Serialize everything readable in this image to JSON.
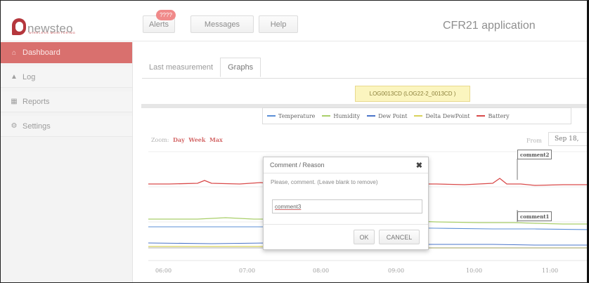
{
  "brand": {
    "name": "newsteo",
    "tagline": "WIRELESS MONITORING"
  },
  "header": {
    "buttons": {
      "alerts": "Alerts",
      "messages": "Messages",
      "help": "Help"
    },
    "alerts_badge": "????",
    "app_title": "CFR21 application"
  },
  "sidebar": {
    "items": [
      {
        "label": "Dashboard",
        "icon": "home-icon"
      },
      {
        "label": "Log",
        "icon": "log-icon"
      },
      {
        "label": "Reports",
        "icon": "reports-icon"
      },
      {
        "label": "Settings",
        "icon": "settings-icon"
      }
    ]
  },
  "tabs": {
    "last": "Last measurement",
    "graphs": "Graphs"
  },
  "logger_label": "LOG0013CD (LOG22-2_0013CD )",
  "legend": [
    {
      "name": "Temperature",
      "color": "#5b8fd6"
    },
    {
      "name": "Humidity",
      "color": "#a9cf6a"
    },
    {
      "name": "Dew Point",
      "color": "#4a74c9"
    },
    {
      "name": "Delta DewPoint",
      "color": "#d8d25a"
    },
    {
      "name": "Battery",
      "color": "#d94a4a"
    }
  ],
  "zoom": {
    "label": "Zoom:",
    "day": "Day",
    "week": "Week",
    "max": "Max"
  },
  "from": {
    "label": "From",
    "value": "Sep 18,"
  },
  "x_ticks": [
    "06:00",
    "07:00",
    "08:00",
    "09:00",
    "10:00",
    "11:00"
  ],
  "annotations": {
    "comment2": "comment2",
    "comment1": "comment1"
  },
  "modal": {
    "title": "Comment / Reason",
    "message": "Please, comment. (Leave blank to remove)",
    "input_value": "comment3",
    "ok": "OK",
    "cancel": "CANCEL"
  },
  "colors": {
    "accent": "#d9706e",
    "battery": "#d94a4a"
  }
}
